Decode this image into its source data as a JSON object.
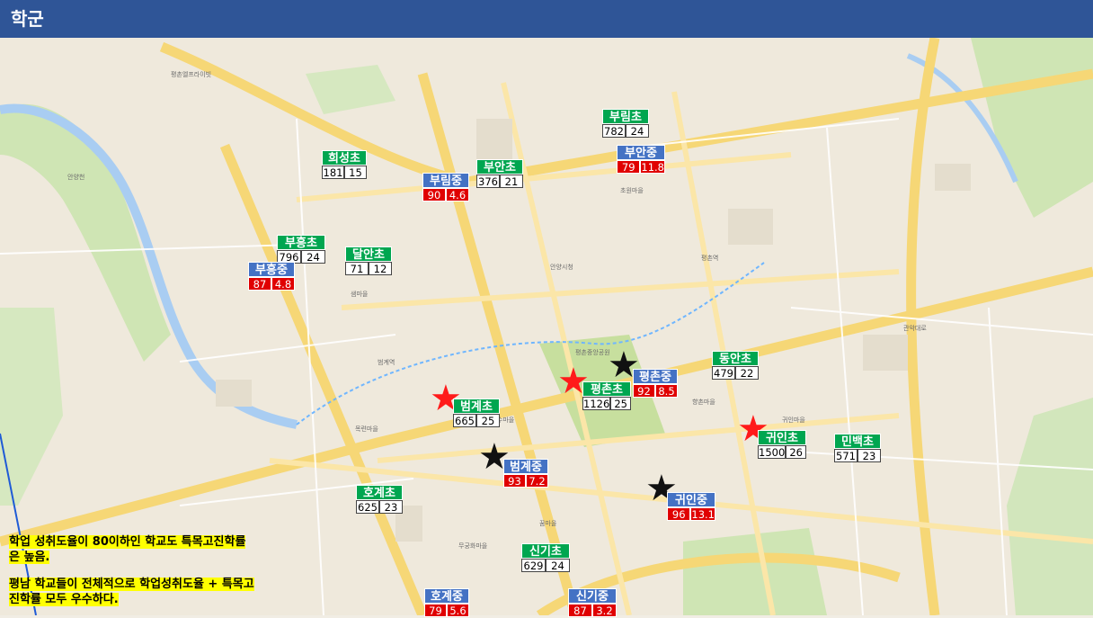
{
  "title": "학군",
  "colors": {
    "header": "#2f5597",
    "elementary": "#00a650",
    "middle": "#4472c4",
    "middle_values": "#e00000",
    "note_highlight": "#ffff00",
    "red_star": "#ff1a1a",
    "black_star": "#111111"
  },
  "schools": [
    {
      "name": "부림초",
      "type": "elementary",
      "v1": "782",
      "v2": "24"
    },
    {
      "name": "부안중",
      "type": "middle",
      "v1": "79",
      "v2": "11.8"
    },
    {
      "name": "희성초",
      "type": "elementary",
      "v1": "181",
      "v2": "15"
    },
    {
      "name": "부안초",
      "type": "elementary",
      "v1": "376",
      "v2": "21"
    },
    {
      "name": "부림중",
      "type": "middle",
      "v1": "90",
      "v2": "4.6"
    },
    {
      "name": "부흥초",
      "type": "elementary",
      "v1": "796",
      "v2": "24"
    },
    {
      "name": "달안초",
      "type": "elementary",
      "v1": "71",
      "v2": "12"
    },
    {
      "name": "부흥중",
      "type": "middle",
      "v1": "87",
      "v2": "4.8"
    },
    {
      "name": "동안초",
      "type": "elementary",
      "v1": "479",
      "v2": "22"
    },
    {
      "name": "평촌중",
      "type": "middle",
      "v1": "92",
      "v2": "8.5"
    },
    {
      "name": "평촌초",
      "type": "elementary",
      "v1": "1126",
      "v2": "25"
    },
    {
      "name": "범계초",
      "type": "elementary",
      "v1": "665",
      "v2": "25"
    },
    {
      "name": "귀인초",
      "type": "elementary",
      "v1": "1500",
      "v2": "26"
    },
    {
      "name": "민백초",
      "type": "elementary",
      "v1": "571",
      "v2": "23"
    },
    {
      "name": "범계중",
      "type": "middle",
      "v1": "93",
      "v2": "7.2"
    },
    {
      "name": "귀인중",
      "type": "middle",
      "v1": "96",
      "v2": "13.1"
    },
    {
      "name": "호계초",
      "type": "elementary",
      "v1": "625",
      "v2": "23"
    },
    {
      "name": "신기초",
      "type": "elementary",
      "v1": "629",
      "v2": "24"
    },
    {
      "name": "호계중",
      "type": "middle",
      "v1": "79",
      "v2": "5.6"
    },
    {
      "name": "신기중",
      "type": "middle",
      "v1": "87",
      "v2": "3.2"
    }
  ],
  "notes": {
    "line1": "학업 성취도율이 80이하인 학교도 특목고진학률",
    "line2": "은 높음.",
    "line3": "평남 학교들이 전체적으로 학업성취도율 + 특목고",
    "line4": "진학률 모두 우수하다."
  },
  "map_labels": {
    "l1": "평촌엘프라이빗",
    "l2": "안양시청",
    "l3": "평촌중앙공원",
    "l4": "범계역",
    "l5": "평촌역",
    "l6": "관악대로",
    "l7": "귀인마을",
    "l8": "목련마을",
    "l9": "무궁화마을",
    "l10": "안양천",
    "l11": "은하수마을",
    "l12": "초원마을",
    "l13": "샘마을",
    "l14": "꿈마을",
    "l15": "향촌마을"
  }
}
